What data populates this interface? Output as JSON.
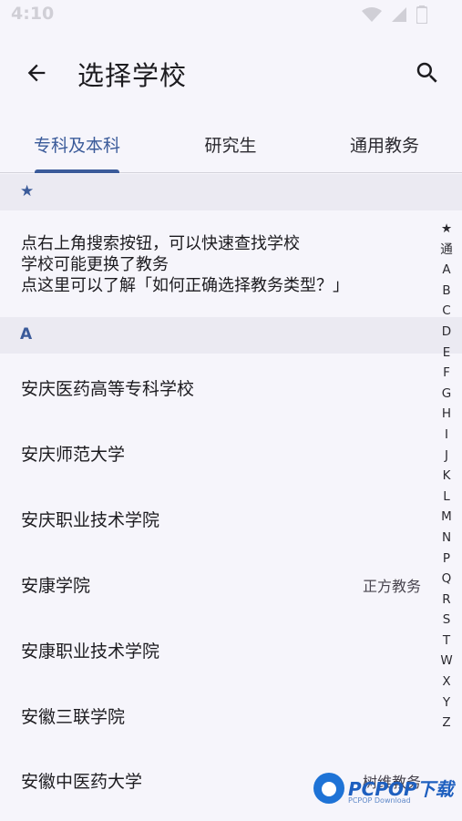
{
  "status_bar": {
    "time": "4:10",
    "icons": [
      "wifi-icon",
      "signal-icon",
      "battery-icon"
    ]
  },
  "app_bar": {
    "title": "选择学校",
    "back_icon": "arrow-left-icon",
    "search_icon": "search-icon"
  },
  "tabs": [
    {
      "label": "专科及本科",
      "active": true
    },
    {
      "label": "研究生",
      "active": false
    },
    {
      "label": "通用教务",
      "active": false
    }
  ],
  "sections": [
    {
      "header": "★"
    },
    {
      "header": "A"
    }
  ],
  "tip": {
    "line1": "点右上角搜索按钮，可以快速查找学校",
    "line2": "学校可能更换了教务",
    "line3": "点这里可以了解「如何正确选择教务类型？」"
  },
  "schools": [
    {
      "name": "安庆医药高等专科学校",
      "tag": ""
    },
    {
      "name": "安庆师范大学",
      "tag": ""
    },
    {
      "name": "安庆职业技术学院",
      "tag": ""
    },
    {
      "name": "安康学院",
      "tag": "正方教务"
    },
    {
      "name": "安康职业技术学院",
      "tag": ""
    },
    {
      "name": "安徽三联学院",
      "tag": ""
    },
    {
      "name": "安徽中医药大学",
      "tag": "树维教务"
    }
  ],
  "index_bar": [
    "★",
    "通",
    "A",
    "B",
    "C",
    "D",
    "E",
    "F",
    "G",
    "H",
    "I",
    "J",
    "K",
    "L",
    "M",
    "N",
    "P",
    "Q",
    "R",
    "S",
    "T",
    "W",
    "X",
    "Y",
    "Z"
  ],
  "watermark": {
    "brand": "PCPOP下载",
    "sub": "PCPOP Download"
  },
  "colors": {
    "accent": "#3b5b9a",
    "background": "#f6f5fb",
    "section_bg": "#ebeaf2"
  }
}
